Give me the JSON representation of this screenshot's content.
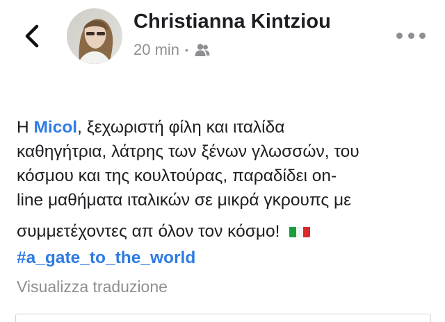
{
  "header": {
    "back_icon": "chevron-left-icon",
    "author_name": "Christianna Kintziou",
    "time": "20 min",
    "separator": "•",
    "audience_icon": "friends-icon",
    "more_icon": "more-horizontal-icon"
  },
  "post": {
    "line1_prefix": "Η ",
    "mention": "Micol",
    "line1_suffix": ", ξεχωριστή  φίλη και ιταλίδα",
    "line2": "καθηγήτρια, λάτρης των ξένων γλωσσών, του",
    "line3": "κόσμου και της κουλτούρας, παραδίδει on-",
    "line4": "line μαθήματα ιταλικών σε μικρά γκρουπς με",
    "line5": "συμμετέχοντες απ όλον τον κόσμο!",
    "flag_icon": "italy-flag-icon",
    "hashtag": "#a_gate_to_the_world"
  },
  "translate_link": "Visualizza traduzione",
  "colors": {
    "link": "#2d7be5",
    "text": "#1c1e21",
    "muted": "#8e8e93"
  }
}
